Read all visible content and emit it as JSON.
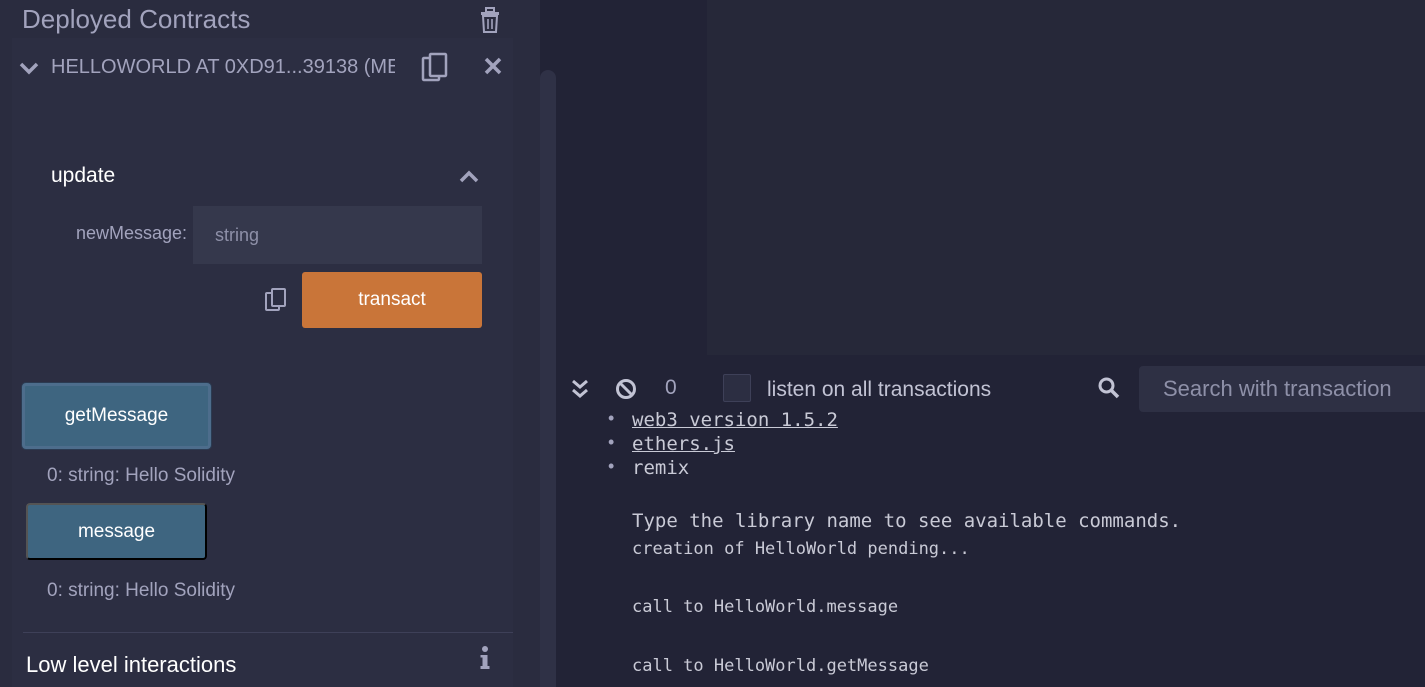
{
  "deployed": {
    "title": "Deployed Contracts",
    "contract_name": "HELLOWORLD AT 0XD91...39138 (ME",
    "update": {
      "function_name": "update",
      "param_label": "newMessage:",
      "param_placeholder": "string",
      "transact_label": "transact"
    },
    "calls": [
      {
        "label": "getMessage",
        "result": "0: string: Hello Solidity"
      },
      {
        "label": "message",
        "result": "0: string: Hello Solidity"
      }
    ],
    "low_level_title": "Low level interactions"
  },
  "terminal": {
    "pending_count": "0",
    "listen_label": "listen on all transactions",
    "search_placeholder": "Search with transaction",
    "libraries": [
      "web3 version 1.5.2",
      "ethers.js",
      "remix"
    ],
    "help_text": "Type the library name to see available commands.",
    "log": [
      "creation of HelloWorld pending...",
      "call to HelloWorld.message",
      "call to HelloWorld.getMessage"
    ]
  },
  "colors": {
    "panel_bg": "#2a2c3f",
    "transact_button": "#c97539",
    "call_button": "#3e6580",
    "terminal_bg": "#222336"
  },
  "icons": [
    "trash-icon",
    "chevron-down-icon",
    "copy-icon",
    "close-icon",
    "chevron-up-icon",
    "info-icon",
    "double-chevron-down-icon",
    "block-icon",
    "search-icon"
  ]
}
